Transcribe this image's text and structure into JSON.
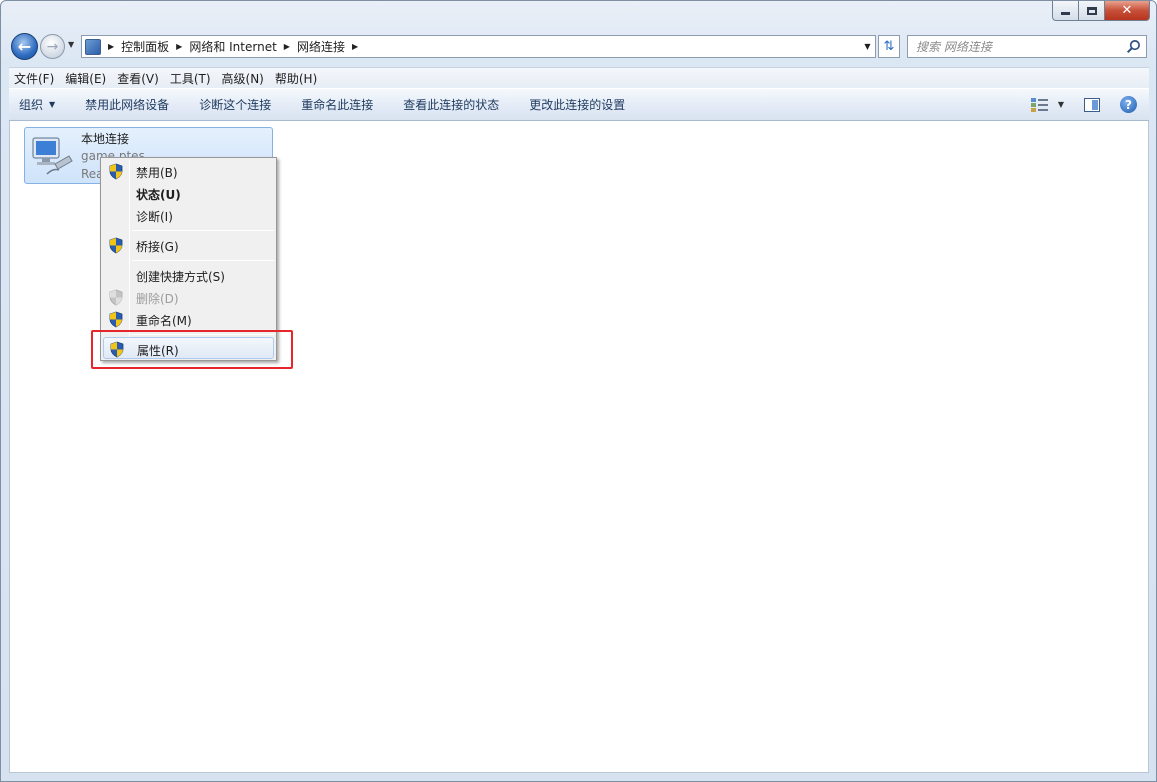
{
  "window": {
    "caption": {
      "minimize": "minimize",
      "maximize": "maximize",
      "close": "✕"
    }
  },
  "nav": {
    "breadcrumbs": [
      "控制面板",
      "网络和 Internet",
      "网络连接"
    ],
    "search_placeholder": "搜索 网络连接"
  },
  "menu": {
    "items": [
      "文件(F)",
      "编辑(E)",
      "查看(V)",
      "工具(T)",
      "高级(N)",
      "帮助(H)"
    ]
  },
  "toolbar": {
    "organize": "组织",
    "disable_device": "禁用此网络设备",
    "diagnose": "诊断这个连接",
    "rename": "重命名此连接",
    "view_status": "查看此连接的状态",
    "change_settings": "更改此连接的设置"
  },
  "connection": {
    "name": "本地连接",
    "network": "game.ptes",
    "adapter": "Rea"
  },
  "context_menu": {
    "disable": "禁用(B)",
    "status": "状态(U)",
    "diagnose": "诊断(I)",
    "bridge": "桥接(G)",
    "create_shortcut": "创建快捷方式(S)",
    "delete": "删除(D)",
    "rename": "重命名(M)",
    "properties": "属性(R)"
  },
  "colors": {
    "highlight_box": "#e8252a",
    "selection": "#cfe3fa",
    "shield_blue": "#2a5db0",
    "shield_yellow": "#f2c418"
  }
}
